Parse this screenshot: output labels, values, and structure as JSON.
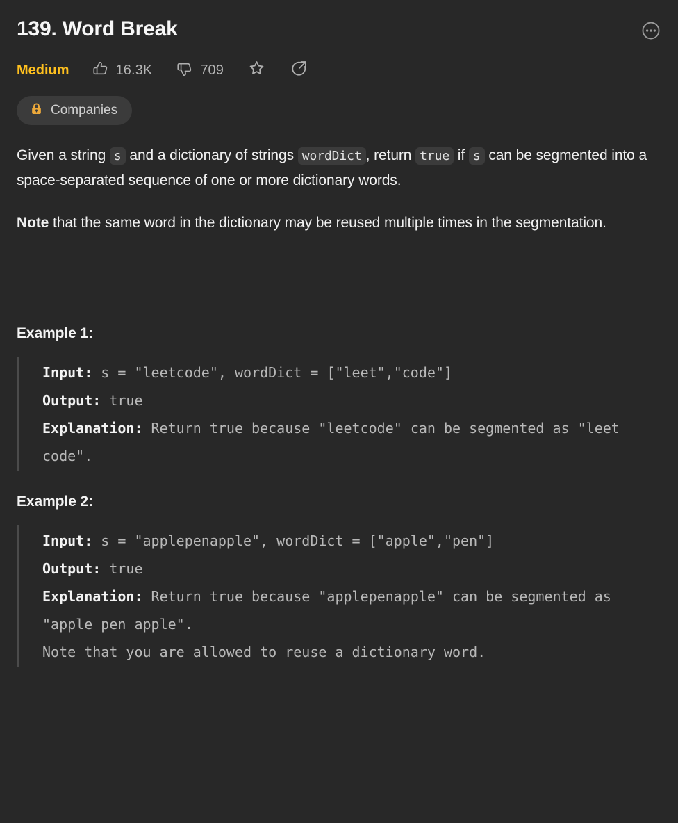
{
  "header": {
    "title": "139. Word Break",
    "more_icon": "ellipsis-circle-icon"
  },
  "meta": {
    "difficulty": "Medium",
    "likes": "16.3K",
    "dislikes": "709",
    "like_icon": "thumbs-up-icon",
    "dislike_icon": "thumbs-down-icon",
    "favorite_icon": "star-icon",
    "share_icon": "share-icon",
    "difficulty_color": "#ffc01e"
  },
  "tags": {
    "companies_label": "Companies",
    "lock_icon": "lock-icon",
    "lock_color": "#eda93a"
  },
  "description": {
    "p1_a": "Given a string ",
    "p1_code1": "s",
    "p1_b": " and a dictionary of strings ",
    "p1_code2": "wordDict",
    "p1_c": ", return ",
    "p1_code3": "true",
    "p1_d": " if ",
    "p1_code4": "s",
    "p1_e": " can be segmented into a space-separated sequence of one or more dictionary words.",
    "p2_bold": "Note",
    "p2_rest": " that the same word in the dictionary may be reused multiple times in the segmentation."
  },
  "examples": [
    {
      "heading": "Example 1:",
      "input_label": "Input:",
      "input_value": " s = \"leetcode\", wordDict = [\"leet\",\"code\"]",
      "output_label": "Output:",
      "output_value": " true",
      "explanation_label": "Explanation:",
      "explanation_value": " Return true because \"leetcode\" can be segmented as \"leet code\"."
    },
    {
      "heading": "Example 2:",
      "input_label": "Input:",
      "input_value": " s = \"applepenapple\", wordDict = [\"apple\",\"pen\"]",
      "output_label": "Output:",
      "output_value": " true",
      "explanation_label": "Explanation:",
      "explanation_value": " Return true because \"applepenapple\" can be segmented as \"apple pen apple\".\nNote that you are allowed to reuse a dictionary word."
    }
  ]
}
